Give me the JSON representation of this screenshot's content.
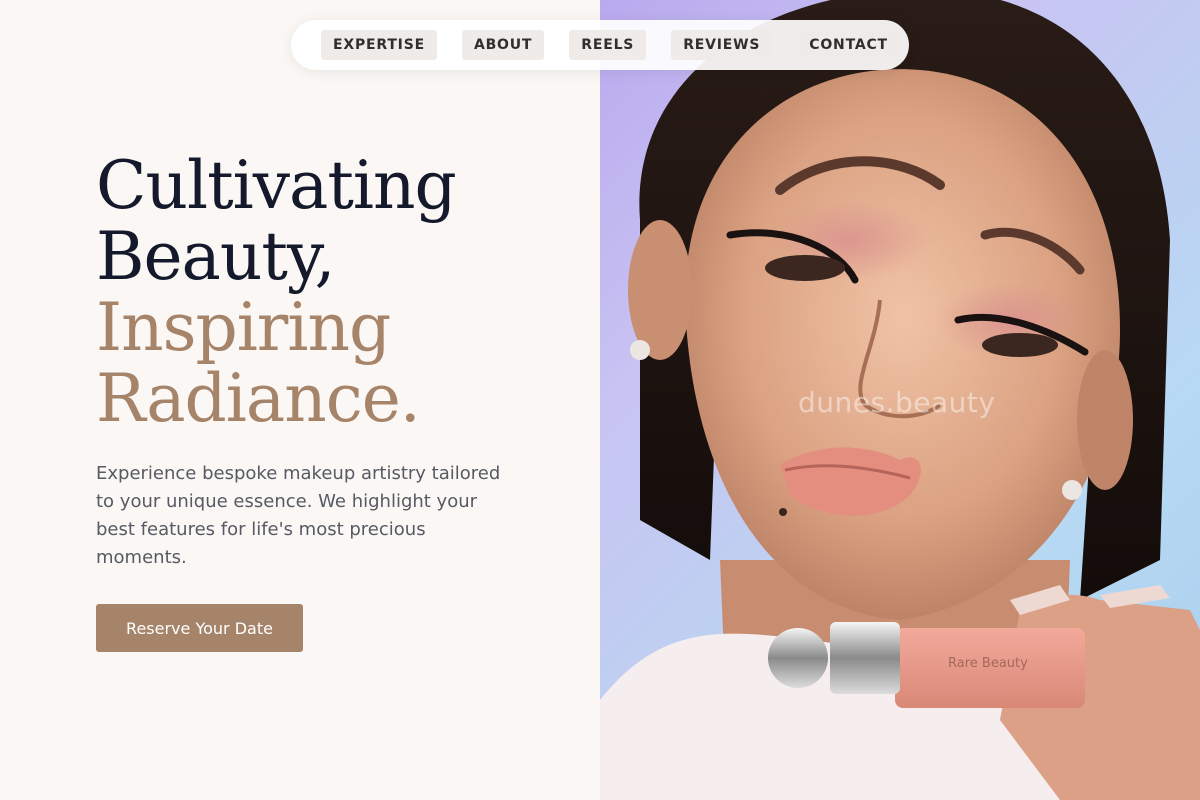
{
  "nav": {
    "items": [
      {
        "label": "EXPERTISE"
      },
      {
        "label": "ABOUT"
      },
      {
        "label": "REELS"
      },
      {
        "label": "REVIEWS"
      },
      {
        "label": "CONTACT"
      }
    ]
  },
  "hero": {
    "headline_line1": "Cultivating",
    "headline_line2": "Beauty,",
    "headline_line3": "Inspiring",
    "headline_line4": "Radiance.",
    "description": "Experience bespoke makeup artistry tailored to your unique essence. We highlight your best features for life's most precious moments.",
    "cta_label": "Reserve Your Date"
  },
  "image": {
    "watermark": "dunes.beauty",
    "product_label": "Rare Beauty"
  },
  "colors": {
    "accent": "#a6846a",
    "heading_dark": "#141a2c",
    "body_text": "#555a63",
    "background": "#fbf7f4"
  }
}
